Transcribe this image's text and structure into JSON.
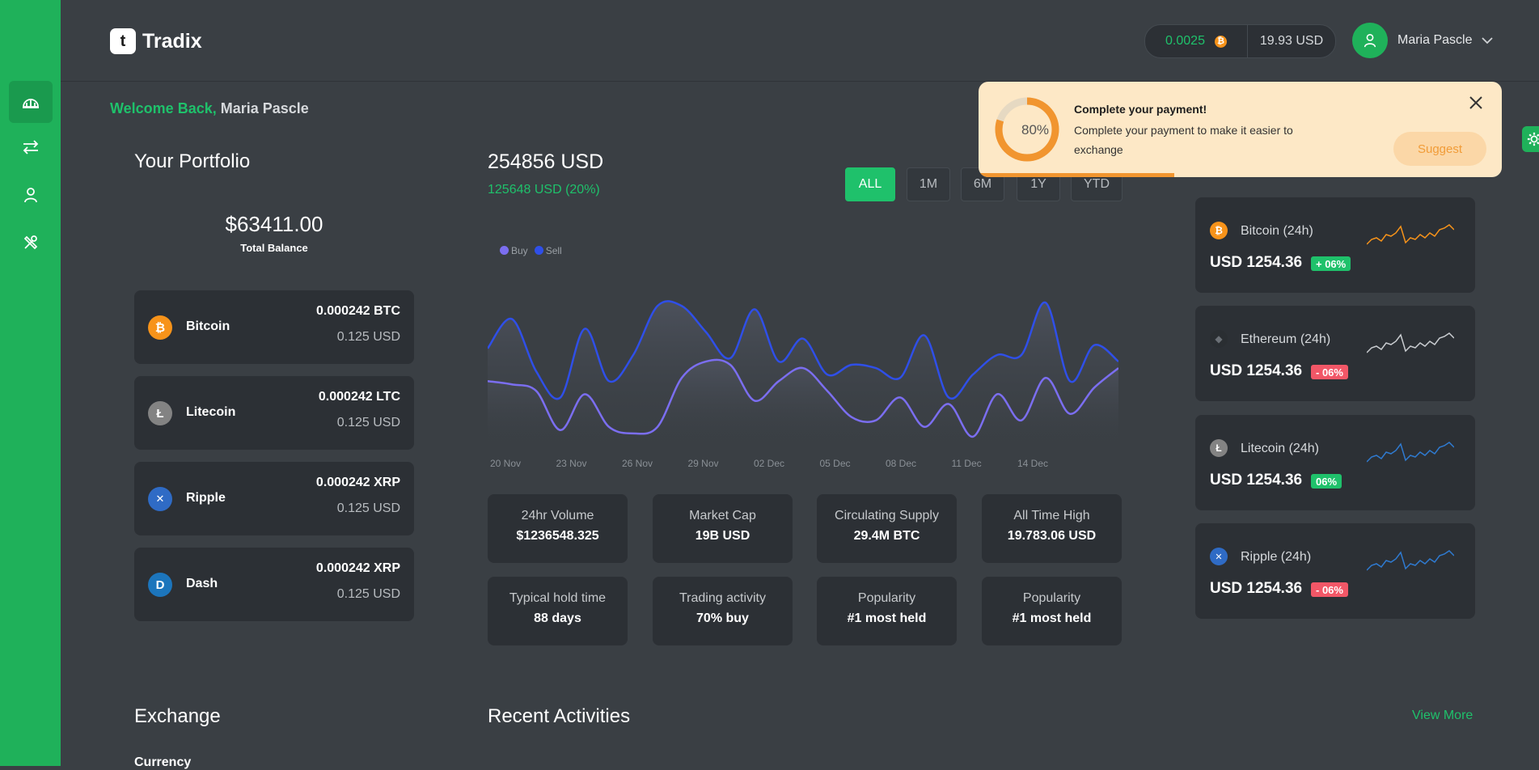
{
  "app": {
    "name": "Tradix"
  },
  "header": {
    "btc_balance": "0.0025",
    "usd_balance": "19.93 USD",
    "user_name": "Maria Pascle"
  },
  "welcome": {
    "greeting": "Welcome Back,",
    "name": "Maria Pascle"
  },
  "portfolio": {
    "title": "Your Portfolio",
    "total_value": "$63411.00",
    "total_label": "Total Balance",
    "coins": [
      {
        "name": "Bitcoin",
        "amount": "0.000242 BTC",
        "usd": "0.125 USD",
        "color": "#f7931a",
        "icon": "bitcoin-icon",
        "glyph": "₿"
      },
      {
        "name": "Litecoin",
        "amount": "0.000242 LTC",
        "usd": "0.125 USD",
        "color": "#838383",
        "icon": "litecoin-icon",
        "glyph": "Ł"
      },
      {
        "name": "Ripple",
        "amount": "0.000242 XRP",
        "usd": "0.125 USD",
        "color": "#2f6bc5",
        "icon": "ripple-icon",
        "glyph": "✕"
      },
      {
        "name": "Dash",
        "amount": "0.000242 XRP",
        "usd": "0.125 USD",
        "color": "#1c75bc",
        "icon": "dash-icon",
        "glyph": "D"
      }
    ]
  },
  "overview": {
    "value": "254856 USD",
    "change": "125648 USD (20%)",
    "ranges": [
      "ALL",
      "1M",
      "6M",
      "1Y",
      "YTD"
    ],
    "active_range": "ALL"
  },
  "chart_data": {
    "type": "area",
    "x": [
      "20 Nov",
      "23 Nov",
      "26 Nov",
      "29 Nov",
      "02 Dec",
      "05 Dec",
      "08 Dec",
      "11 Dec",
      "14 Dec"
    ],
    "series": [
      {
        "name": "Buy",
        "color": "#7b6ef0",
        "values": [
          40,
          38,
          34,
          10,
          32,
          12,
          8,
          12,
          42,
          52,
          50,
          28,
          40,
          48,
          34,
          18,
          16,
          30,
          12,
          26,
          6,
          32,
          16,
          42,
          20,
          36,
          48
        ]
      },
      {
        "name": "Sell",
        "color": "#2f4fe8",
        "values": [
          60,
          78,
          46,
          30,
          72,
          40,
          56,
          86,
          86,
          70,
          54,
          84,
          52,
          66,
          44,
          50,
          48,
          42,
          68,
          30,
          44,
          56,
          56,
          88,
          40,
          62,
          52
        ]
      }
    ],
    "ylim": [
      0,
      100
    ],
    "grid": false,
    "legend": "top-left"
  },
  "stats": [
    {
      "title": "24hr Volume",
      "value": "$1236548.325"
    },
    {
      "title": "Market Cap",
      "value": "19B USD"
    },
    {
      "title": "Circulating Supply",
      "value": "29.4M BTC"
    },
    {
      "title": "All Time High",
      "value": "19.783.06 USD"
    },
    {
      "title": "Typical hold time",
      "value": "88 days"
    },
    {
      "title": "Trading activity",
      "value": "70% buy"
    },
    {
      "title": "Popularity",
      "value": "#1 most held"
    },
    {
      "title": "Popularity",
      "value": "#1 most held"
    }
  ],
  "markets": [
    {
      "name": "Bitcoin (24h)",
      "price": "USD 1254.36",
      "badge": "+ 06%",
      "badge_bg": "#1fc16b",
      "icon_bg": "#f7931a",
      "glyph": "₿",
      "spark": "#f7931a",
      "icon": "bitcoin-icon"
    },
    {
      "name": "Ethereum (24h)",
      "price": "USD 1254.36",
      "badge": "- 06%",
      "badge_bg": "#f25767",
      "icon_bg": "#2a2e32",
      "glyph": "◆",
      "spark": "#c9ccd0",
      "icon": "ethereum-icon"
    },
    {
      "name": "Litecoin (24h)",
      "price": "USD 1254.36",
      "badge": "06%",
      "badge_bg": "#1fc16b",
      "icon_bg": "#838383",
      "glyph": "Ł",
      "spark": "#2f7ad0",
      "icon": "litecoin-icon"
    },
    {
      "name": "Ripple (24h)",
      "price": "USD 1254.36",
      "badge": "- 06%",
      "badge_bg": "#f25767",
      "icon_bg": "#2f6bc5",
      "glyph": "✕",
      "spark": "#2f7ad0",
      "icon": "ripple-icon"
    }
  ],
  "toast": {
    "percent": "80%",
    "progress": 0.8,
    "title": "Complete your payment!",
    "message": "Complete your payment to make it easier to exchange",
    "action": "Suggest"
  },
  "sections": {
    "exchange": "Exchange",
    "recent": "Recent Activities",
    "view_more": "View More",
    "currency_label": "Currency"
  }
}
